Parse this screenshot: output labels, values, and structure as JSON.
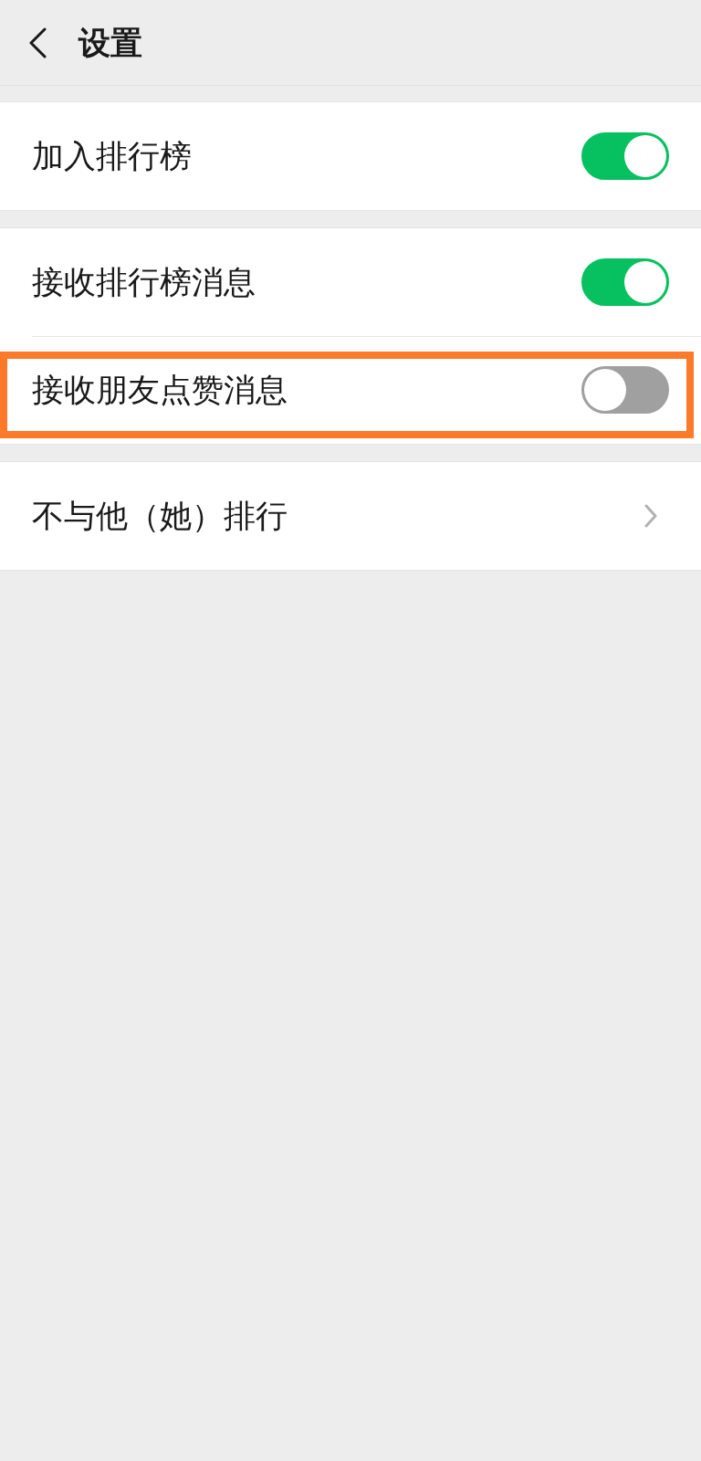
{
  "header": {
    "title": "设置"
  },
  "groups": [
    {
      "items": [
        {
          "kind": "toggle",
          "label": "加入排行榜",
          "on": true,
          "highlighted": false
        }
      ]
    },
    {
      "items": [
        {
          "kind": "toggle",
          "label": "接收排行榜消息",
          "on": true,
          "highlighted": false
        },
        {
          "kind": "toggle",
          "label": "接收朋友点赞消息",
          "on": false,
          "highlighted": true
        }
      ]
    },
    {
      "items": [
        {
          "kind": "link",
          "label": "不与他（她）排行",
          "highlighted": false
        }
      ]
    }
  ]
}
